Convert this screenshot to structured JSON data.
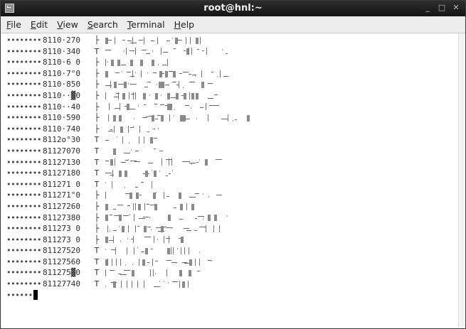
{
  "window": {
    "title": "root@hnl:~",
    "buttons": [
      "_",
      "□",
      "✕"
    ]
  },
  "menu": [
    {
      "mnemonic": "F",
      "rest": "ile"
    },
    {
      "mnemonic": "E",
      "rest": "dit"
    },
    {
      "mnemonic": "V",
      "rest": "iew"
    },
    {
      "mnemonic": "S",
      "rest": "earch"
    },
    {
      "mnemonic": "T",
      "rest": "erminal"
    },
    {
      "mnemonic": "H",
      "rest": "elp"
    }
  ],
  "terminal": {
    "prefix": "••••••••",
    "lines": [
      {
        "addr": "8110·270",
        "flag": "├"
      },
      {
        "addr": "8110·340",
        "flag": "T"
      },
      {
        "addr": "8110·6 0",
        "flag": "├"
      },
      {
        "addr": "8110·7°0",
        "flag": "├"
      },
      {
        "addr": "8110·850",
        "flag": "├"
      },
      {
        "addr": "8110··▓0",
        "flag": "├"
      },
      {
        "addr": "8110··40",
        "flag": "├"
      },
      {
        "addr": "8110·590",
        "flag": "├"
      },
      {
        "addr": "8110·740",
        "flag": "├"
      },
      {
        "addr": "8112o°30",
        "flag": "T"
      },
      {
        "addr": "81127070",
        "flag": "T"
      },
      {
        "addr": "81127130",
        "flag": "T"
      },
      {
        "addr": "81127180",
        "flag": "T"
      },
      {
        "addr": "811271 0",
        "flag": "T"
      },
      {
        "addr": "811271°0",
        "flag": "├"
      },
      {
        "addr": "81127260",
        "flag": "├"
      },
      {
        "addr": "81127380",
        "flag": "├"
      },
      {
        "addr": "811273 0",
        "flag": "├"
      },
      {
        "addr": "811273 0",
        "flag": "├"
      },
      {
        "addr": "81127520",
        "flag": "T"
      },
      {
        "addr": "81127560",
        "flag": "T"
      },
      {
        "addr": "811275▓0",
        "flag": "T"
      },
      {
        "addr": "81127740",
        "flag": "T"
      }
    ],
    "prompt_prefix": "••••••"
  }
}
